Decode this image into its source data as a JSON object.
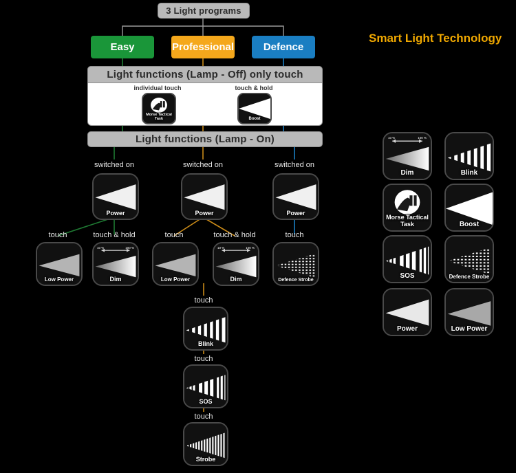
{
  "brand": {
    "title": "Smart Light Technology",
    "color": "#f0a800"
  },
  "header": {
    "root_label": "3 Light programs"
  },
  "programs": [
    {
      "name": "easy",
      "label": "Easy",
      "color": "#1a9639"
    },
    {
      "name": "professional",
      "label": "Professional",
      "color": "#f5a81c"
    },
    {
      "name": "defence",
      "label": "Defence",
      "color": "#1a7ec2"
    }
  ],
  "bands": {
    "lamp_off": "Light functions (Lamp - Off) only touch",
    "lamp_on": "Light functions (Lamp - On)"
  },
  "lamp_off_panel": {
    "left_label": "individual touch",
    "right_label": "touch & hold",
    "left_tile": {
      "label": "Morse Tactical Task",
      "icon": "morse-tactical-task-icon"
    },
    "right_tile": {
      "label": "Boost",
      "icon": "boost-icon"
    }
  },
  "dim_scale": {
    "min": "10 %",
    "max": "100 %"
  },
  "tree": {
    "easy": {
      "root": {
        "edge": "switched on",
        "label": "Power",
        "icon": "power-icon"
      },
      "children": [
        {
          "edge": "touch",
          "label": "Low Power",
          "icon": "low-power-icon"
        },
        {
          "edge": "touch & hold",
          "label": "Dim",
          "icon": "dim-icon"
        }
      ]
    },
    "professional": {
      "root": {
        "edge": "switched on",
        "label": "Power",
        "icon": "power-icon"
      },
      "children": [
        {
          "edge": "touch",
          "label": "Low Power",
          "icon": "low-power-icon"
        },
        {
          "edge": "touch & hold",
          "label": "Dim",
          "icon": "dim-icon"
        }
      ],
      "chain": [
        {
          "edge": "touch",
          "label": "Blink",
          "icon": "blink-icon"
        },
        {
          "edge": "touch",
          "label": "SOS",
          "icon": "sos-icon"
        },
        {
          "edge": "touch",
          "label": "Strobe",
          "icon": "strobe-icon"
        }
      ]
    },
    "defence": {
      "root": {
        "edge": "switched on",
        "label": "Power",
        "icon": "power-icon"
      },
      "children": [
        {
          "edge": "touch",
          "label": "Defence Strobe",
          "icon": "defence-strobe-icon"
        }
      ]
    }
  },
  "legend": {
    "items": [
      {
        "label": "Dim",
        "icon": "dim-icon"
      },
      {
        "label": "Blink",
        "icon": "blink-icon"
      },
      {
        "label": "Morse Tactical Task",
        "icon": "morse-tactical-task-icon"
      },
      {
        "label": "Boost",
        "icon": "boost-icon"
      },
      {
        "label": "SOS",
        "icon": "sos-icon"
      },
      {
        "label": "Defence Strobe",
        "icon": "defence-strobe-icon"
      },
      {
        "label": "Power",
        "icon": "power-icon"
      },
      {
        "label": "Low Power",
        "icon": "low-power-icon"
      }
    ]
  },
  "colors": {
    "background": "#000000",
    "band": "#b9b9b9",
    "wire_easy": "#1f7a33",
    "wire_professional": "#c98a18",
    "wire_defence": "#1a6ea8",
    "wire_grey": "#9a9a9a"
  }
}
